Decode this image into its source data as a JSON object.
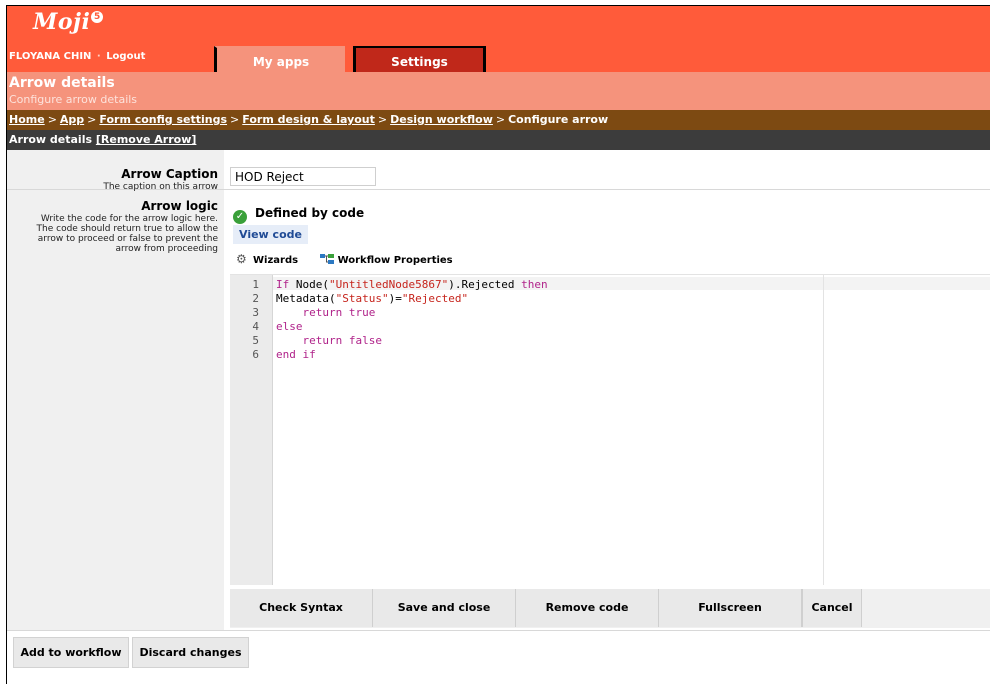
{
  "app": {
    "logo": "Moji",
    "logo_badge": "5"
  },
  "user": {
    "name": "FLOYANA CHIN",
    "separator": "·",
    "logout": "Logout"
  },
  "tabs": [
    {
      "label": "My apps"
    },
    {
      "label": "Settings"
    }
  ],
  "page": {
    "title": "Arrow details",
    "subtitle": "Configure arrow details"
  },
  "breadcrumb": [
    {
      "label": "Home"
    },
    {
      "label": "App"
    },
    {
      "label": "Form config settings"
    },
    {
      "label": "Form design & layout"
    },
    {
      "label": "Design workflow"
    },
    {
      "label": "Configure arrow"
    }
  ],
  "breadcrumb_sep": ">",
  "section": {
    "title": "Arrow details",
    "remove_link": "[Remove Arrow]"
  },
  "caption_field": {
    "label": "Arrow Caption",
    "description": "The caption on this arrow",
    "value": "HOD Reject"
  },
  "logic_field": {
    "label": "Arrow logic",
    "description_lines": [
      "Write the code for the arrow logic here.",
      "The code should return true to allow the",
      "arrow to proceed or false to prevent the",
      "arrow from proceeding"
    ],
    "status": "Defined by code",
    "view_code": "View code"
  },
  "tools": {
    "wizards": "Wizards",
    "workflow_properties": "Workflow Properties"
  },
  "editor": {
    "line_numbers": [
      "1",
      "2",
      "3",
      "4",
      "5",
      "6"
    ],
    "code": {
      "l1_kw1": "If",
      "l1_a": " Node(",
      "l1_str": "\"UntitledNode5867\"",
      "l1_b": ").Rejected ",
      "l1_kw2": "then",
      "l2_a": "Metadata(",
      "l2_str1": "\"Status\"",
      "l2_b": ")=",
      "l2_str2": "\"Rejected\"",
      "l3_indent": "    ",
      "l3_kw": "return true",
      "l4_kw": "else",
      "l5_indent": "    ",
      "l5_kw": "return false",
      "l6_kw": "end if"
    }
  },
  "editor_buttons": {
    "check_syntax": "Check Syntax",
    "save_and_close": "Save and close",
    "remove_code": "Remove code",
    "fullscreen": "Fullscreen",
    "cancel": "Cancel"
  },
  "footer_buttons": {
    "add_to_workflow": "Add to workflow",
    "discard_changes": "Discard changes"
  },
  "colors": {
    "header": "#ff5b3a",
    "subheader": "#f5937c",
    "breadcrumb_bar": "#7d4a12",
    "section_bar": "#3c3c3c",
    "settings_tab": "#c0281a",
    "keyword": "#b0238a",
    "string": "#c6241c"
  }
}
